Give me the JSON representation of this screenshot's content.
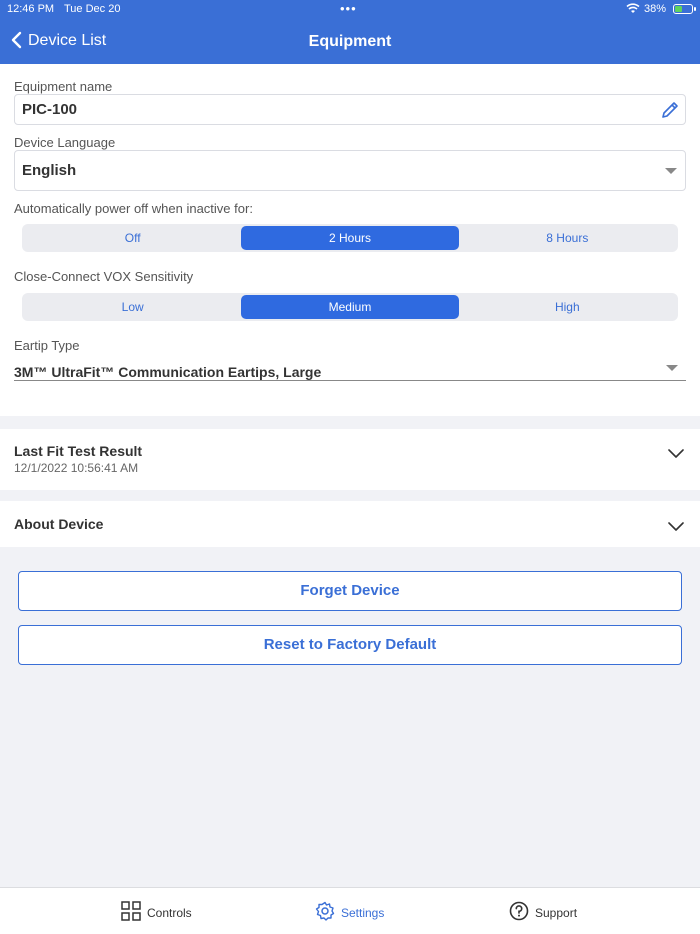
{
  "status_bar": {
    "time": "12:46 PM",
    "date": "Tue Dec 20",
    "multitask_dots": "•••",
    "battery_percent": "38%",
    "battery_charging": true
  },
  "nav": {
    "back_label": "Device List",
    "title": "Equipment"
  },
  "equipment": {
    "name_label": "Equipment name",
    "name_value": "PIC-100",
    "language_label": "Device Language",
    "language_value": "English",
    "power_off_label": "Automatically power off when inactive for:",
    "power_off_options": [
      "Off",
      "2 Hours",
      "8 Hours"
    ],
    "power_off_selected": "2 Hours",
    "vox_label": "Close-Connect VOX Sensitivity",
    "vox_options": [
      "Low",
      "Medium",
      "High"
    ],
    "vox_selected": "Medium",
    "eartip_label": "Eartip Type",
    "eartip_value": "3M™ UltraFit™ Communication Eartips, Large"
  },
  "fit_test": {
    "title": "Last Fit Test Result",
    "timestamp": "12/1/2022 10:56:41 AM"
  },
  "about": {
    "title": "About Device"
  },
  "actions": {
    "forget_label": "Forget Device",
    "reset_label": "Reset to Factory Default"
  },
  "tabbar": {
    "controls_label": "Controls",
    "settings_label": "Settings",
    "support_label": "Support",
    "active_tab": "Settings"
  },
  "colors": {
    "accent": "#3a6fd6",
    "segment_active": "#2f6ae0",
    "background": "#f1f2f6"
  }
}
